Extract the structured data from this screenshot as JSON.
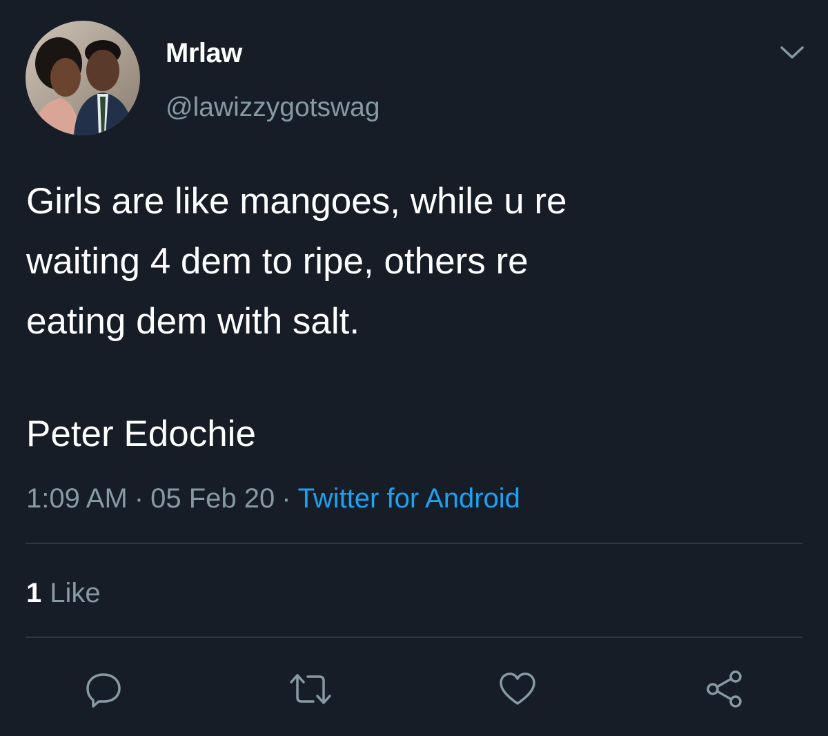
{
  "user": {
    "display_name": "Mrlaw",
    "handle": "@lawizzygotswag",
    "avatar_icon": "profile-photo"
  },
  "tweet": {
    "lines": [
      "Girls are like mangoes, while u re",
      "waiting 4 dem to ripe, others re",
      "eating dem with salt."
    ],
    "signature": "Peter Edochie"
  },
  "meta": {
    "time": "1:09 AM",
    "separator": "·",
    "date": "05 Feb 20",
    "source": "Twitter for Android"
  },
  "stats": {
    "likes_count": "1",
    "likes_label": "Like"
  },
  "actions": [
    {
      "name": "reply",
      "icon": "reply-icon"
    },
    {
      "name": "retweet",
      "icon": "retweet-icon"
    },
    {
      "name": "like",
      "icon": "heart-icon"
    },
    {
      "name": "share",
      "icon": "share-icon"
    }
  ],
  "colors": {
    "background": "#161d27",
    "primary_text": "#ffffff",
    "secondary_text": "#8899a6",
    "accent": "#1da1f2",
    "divider": "#2d3843"
  }
}
